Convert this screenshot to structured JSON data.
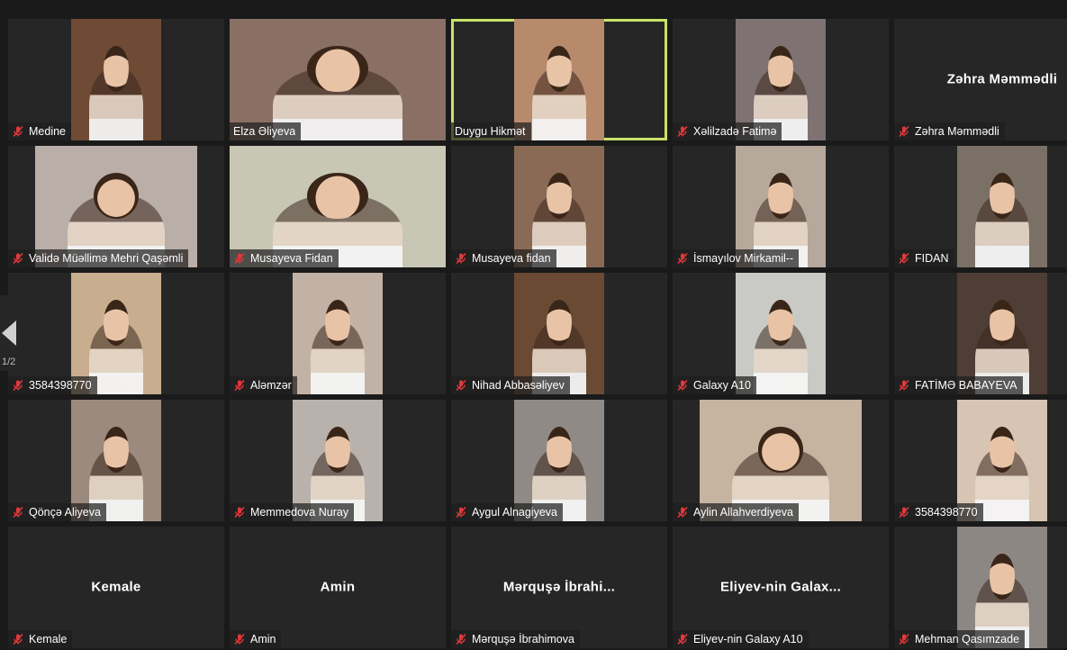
{
  "pager": {
    "page_label": "1/2",
    "prev_icon": "chevron-left-icon"
  },
  "colors": {
    "active_speaker": "#c9e26a",
    "muted_mic": "#e0383b",
    "tile_bg": "#262626",
    "page_bg": "#1a1a1a"
  },
  "tiles": [
    {
      "label": "Medine",
      "muted": true,
      "video": true,
      "bg": "#6f4b36"
    },
    {
      "label": "Elza Əliyeva",
      "muted": false,
      "video": true,
      "bg": "#8a6f65"
    },
    {
      "label": "Duygu Hikmət",
      "muted": false,
      "video": true,
      "bg": "#b88a6c",
      "active": true
    },
    {
      "label": "Xəlilzadə Fatimə",
      "muted": true,
      "video": true,
      "bg": "#7e7272"
    },
    {
      "label": "Zəhra Məmmədli",
      "muted": true,
      "video": false,
      "display_name": "Zəhra Məmmədli"
    },
    {
      "label": "Validə Müəllimə  Mehri Qaşəmli",
      "muted": true,
      "video": true,
      "bg": "#b9aea8"
    },
    {
      "label": "Musayeva Fidan",
      "muted": true,
      "video": true,
      "bg": "#c8c7b6"
    },
    {
      "label": "Musayeva fidan",
      "muted": true,
      "video": true,
      "bg": "#8a6a55"
    },
    {
      "label": "İsmayılov Mirkamil--",
      "muted": true,
      "video": true,
      "bg": "#b7a89c"
    },
    {
      "label": "FIDAN",
      "muted": true,
      "video": true,
      "bg": "#7a7066"
    },
    {
      "label": "3584398770",
      "muted": true,
      "video": true,
      "bg": "#c8ad8e"
    },
    {
      "label": "Aləmzər",
      "muted": true,
      "video": true,
      "bg": "#c2b2a5"
    },
    {
      "label": "Nihad Abbasəliyev",
      "muted": true,
      "video": true,
      "bg": "#6a4a33"
    },
    {
      "label": "Galaxy A10",
      "muted": true,
      "video": true,
      "bg": "#c9cac5"
    },
    {
      "label": "FATİMƏ BABAYEVA",
      "muted": true,
      "video": true,
      "bg": "#4e3e36"
    },
    {
      "label": "Qönçə Aliyeva",
      "muted": true,
      "video": true,
      "bg": "#9b8a7d"
    },
    {
      "label": "Memmedova Nuray",
      "muted": true,
      "video": true,
      "bg": "#b9b2ac"
    },
    {
      "label": "Aygul Alnagiyeva",
      "muted": true,
      "video": true,
      "bg": "#8f8a86"
    },
    {
      "label": "Aylin Allahverdiyeva",
      "muted": true,
      "video": true,
      "bg": "#c6b3a0"
    },
    {
      "label": "3584398770",
      "muted": true,
      "video": true,
      "bg": "#d8c4b3"
    },
    {
      "label": "Kemale",
      "muted": true,
      "video": false,
      "display_name": "Kemale"
    },
    {
      "label": "Amin",
      "muted": true,
      "video": false,
      "display_name": "Amin"
    },
    {
      "label": "Mərquşə İbrahimova",
      "muted": true,
      "video": false,
      "display_name": "Mərquşə  İbrahi..."
    },
    {
      "label": "Eliyev-nin Galaxy A10",
      "muted": true,
      "video": false,
      "display_name": "Eliyev-nin  Galax..."
    },
    {
      "label": "Mehman Qasımzade",
      "muted": true,
      "video": true,
      "bg": "#8d8784"
    }
  ]
}
